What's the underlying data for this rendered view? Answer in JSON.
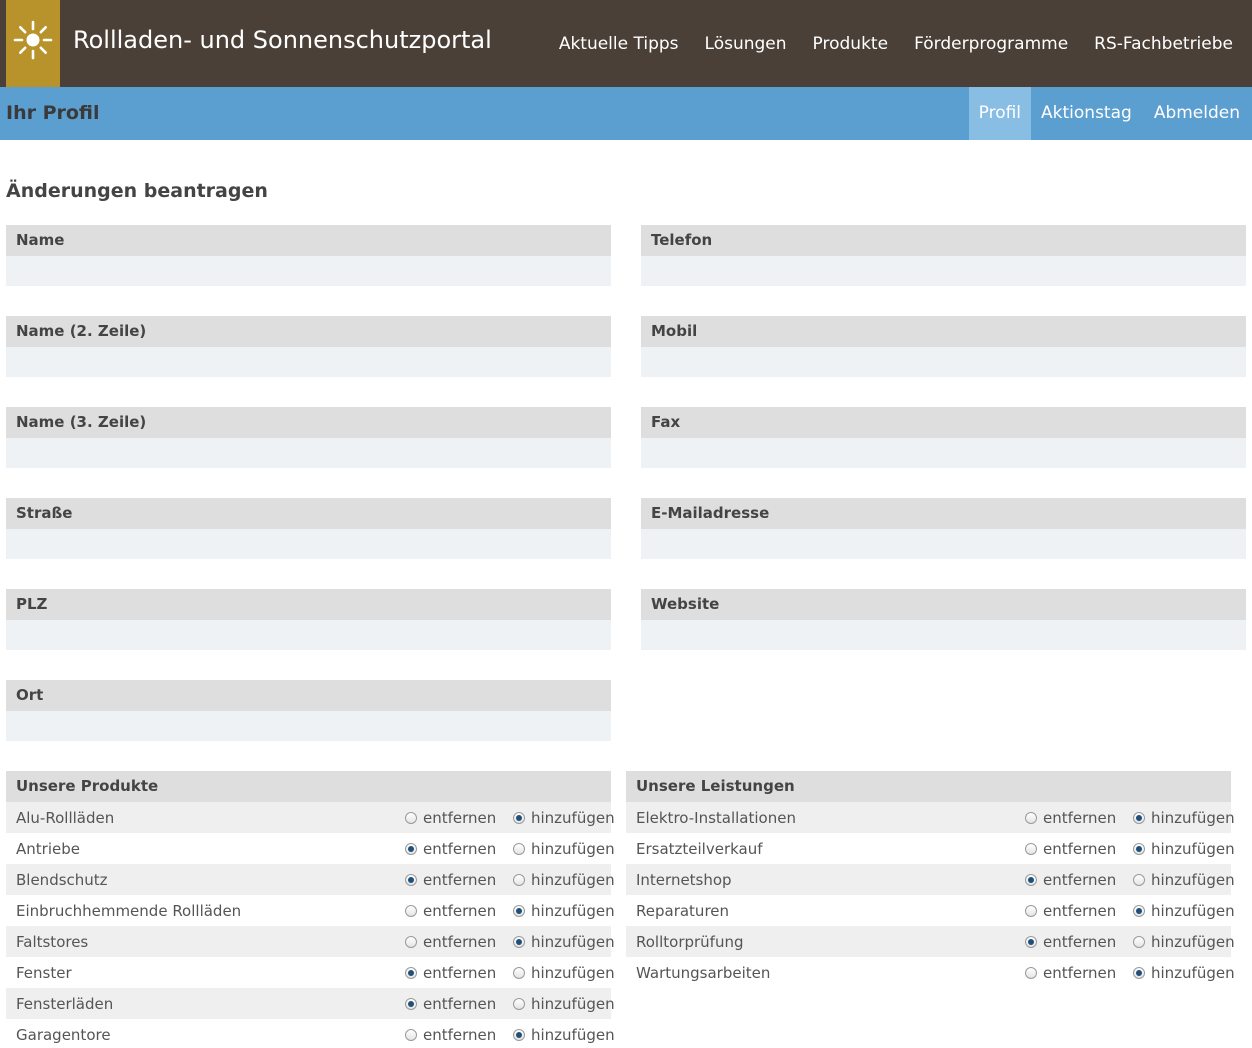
{
  "header": {
    "site_title": "Rollladen- und Sonnenschutzportal",
    "nav": [
      "Aktuelle Tipps",
      "Lösungen",
      "Produkte",
      "Förderprogramme",
      "RS-Fachbetriebe"
    ]
  },
  "subheader": {
    "title": "Ihr Profil",
    "nav": [
      "Profil",
      "Aktionstag",
      "Abmelden"
    ],
    "active": "Profil"
  },
  "form": {
    "heading": "Änderungen beantragen",
    "left_fields": [
      {
        "label": "Name",
        "value": ""
      },
      {
        "label": "Name (2. Zeile)",
        "value": ""
      },
      {
        "label": "Name (3. Zeile)",
        "value": ""
      },
      {
        "label": "Straße",
        "value": ""
      },
      {
        "label": "PLZ",
        "value": ""
      },
      {
        "label": "Ort",
        "value": ""
      }
    ],
    "right_fields": [
      {
        "label": "Telefon",
        "value": ""
      },
      {
        "label": "Mobil",
        "value": ""
      },
      {
        "label": "Fax",
        "value": ""
      },
      {
        "label": "E-Mailadresse",
        "value": ""
      },
      {
        "label": "Website",
        "value": ""
      }
    ]
  },
  "option_labels": {
    "remove": "entfernen",
    "add": "hinzufügen"
  },
  "products": {
    "heading": "Unsere Produkte",
    "items": [
      {
        "name": "Alu-Rollläden",
        "selected": "add"
      },
      {
        "name": "Antriebe",
        "selected": "remove"
      },
      {
        "name": "Blendschutz",
        "selected": "remove"
      },
      {
        "name": "Einbruchhemmende Rollläden",
        "selected": "add"
      },
      {
        "name": "Faltstores",
        "selected": "add"
      },
      {
        "name": "Fenster",
        "selected": "remove"
      },
      {
        "name": "Fensterläden",
        "selected": "remove"
      },
      {
        "name": "Garagentore",
        "selected": "add"
      }
    ]
  },
  "services": {
    "heading": "Unsere Leistungen",
    "items": [
      {
        "name": "Elektro-Installationen",
        "selected": "add"
      },
      {
        "name": "Ersatzteilverkauf",
        "selected": "add"
      },
      {
        "name": "Internetshop",
        "selected": "remove"
      },
      {
        "name": "Reparaturen",
        "selected": "add"
      },
      {
        "name": "Rolltorprüfung",
        "selected": "remove"
      },
      {
        "name": "Wartungsarbeiten",
        "selected": "add"
      }
    ]
  },
  "colors": {
    "header_bg": "#4b4038",
    "logo_bg": "#b8922a",
    "subheader_bg": "#5b9fd1",
    "subnav_active_bg": "#88bde4"
  },
  "icons": {
    "logo": "sun-icon"
  }
}
